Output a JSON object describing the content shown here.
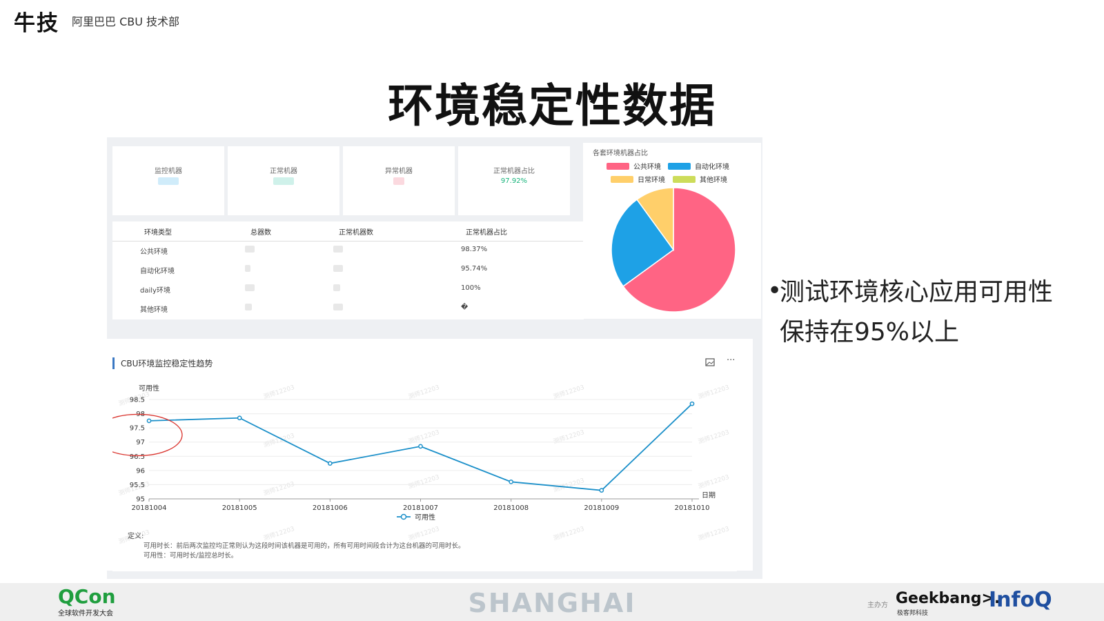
{
  "header": {
    "brand": "牛技",
    "org": "阿里巴巴 CBU 技术部"
  },
  "title": "环境稳定性数据",
  "cards": [
    {
      "label": "监控机器",
      "value": "",
      "blur_color": "#a9dcf5"
    },
    {
      "label": "正常机器",
      "value": "",
      "blur_color": "#a8e6d8"
    },
    {
      "label": "异常机器",
      "value": "",
      "blur_color": "#f7b9c4"
    },
    {
      "label": "正常机器占比",
      "value": "97.92%",
      "blur_color": ""
    }
  ],
  "table": {
    "headers": [
      "环境类型",
      "总器数",
      "正常机器数",
      "正常机器占比"
    ],
    "rows": [
      {
        "type": "公共环境",
        "ratio": "98.37%"
      },
      {
        "type": "自动化环境",
        "ratio": "95.74%"
      },
      {
        "type": "daily环境",
        "ratio": "100%"
      },
      {
        "type": "其他环境",
        "ratio": "�"
      }
    ]
  },
  "pie": {
    "title": "各套环境机器占比",
    "legend": [
      {
        "name": "公共环境",
        "color": "#ff6484"
      },
      {
        "name": "自动化环境",
        "color": "#1ea1e6"
      },
      {
        "name": "日常环境",
        "color": "#ffcf6a"
      },
      {
        "name": "其他环境",
        "color": "#cddc5a"
      }
    ],
    "shares": [
      0.65,
      0.25,
      0.1,
      0
    ]
  },
  "line_panel": {
    "title": "CBU环境监控稳定性趋势",
    "image_icon": "image-download-icon",
    "more_icon": "more-icon",
    "definition_label": "定义:",
    "definition_lines": [
      "可用时长：前后两次监控均正常则认为这段时间该机器是可用的，所有可用时间段合计为这台机器的可用时长。",
      "可用性：可用时长/监控总时长。"
    ],
    "watermark": "测师12203"
  },
  "chart_data": {
    "type": "line",
    "title": "",
    "ylabel": "可用性",
    "xlabel": "日期",
    "categories": [
      "20181004",
      "20181005",
      "20181006",
      "20181007",
      "20181008",
      "20181009",
      "20181010"
    ],
    "series": [
      {
        "name": "可用性",
        "values": [
          97.75,
          97.85,
          96.25,
          96.85,
          95.6,
          95.3,
          98.35
        ],
        "color": "#1a8fc9"
      }
    ],
    "ylim": [
      95,
      98.5
    ],
    "yticks": [
      "95",
      "95.5",
      "96",
      "96.5",
      "97",
      "97.5",
      "98",
      "98.5"
    ],
    "grid": true,
    "legend": "bottom"
  },
  "bullet": {
    "text": "测试环境核心应用可用性保持在95%以上"
  },
  "footer": {
    "qcon": "QCon",
    "qcon_sub": "全球软件开发大会",
    "city": "SHANGHAI",
    "sponsor_label": "主办方",
    "geek": "Geekbang>.",
    "geek_sub": "极客邦科技",
    "infoq": "InfoQ"
  }
}
